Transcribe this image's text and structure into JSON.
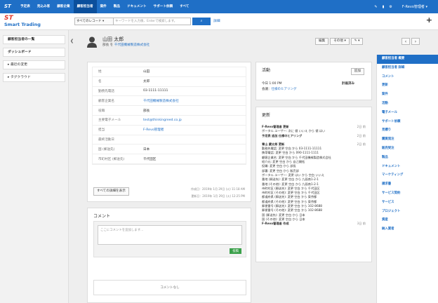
{
  "topnav": [
    "予定表",
    "見込み客",
    "顧客企業",
    "顧客担当者",
    "案件",
    "製品",
    "ドキュメント",
    "サポート依頼",
    "すべて"
  ],
  "topnav_active": 3,
  "user": "F-Revo管理者",
  "brand": {
    "st": "ST",
    "name": "Smart Trading"
  },
  "search": {
    "scope": "すべてのレコード",
    "placeholder": "キーワードを入力後、Enterで検索します。",
    "detail": "詳細"
  },
  "sidebar": {
    "items": [
      "顧客担当者の一覧",
      "ダッシュボード",
      "最近の変更",
      "タグクラウド"
    ]
  },
  "record": {
    "name": "山田 太郎",
    "role_prefix": "部長 を",
    "company": "千代田機械製造株式会社"
  },
  "actions": {
    "edit": "編集",
    "other": "その他",
    "tools": "🔧"
  },
  "fields": [
    {
      "label": "姓",
      "value": "山田",
      "link": false
    },
    {
      "label": "名",
      "value": "太郎",
      "link": false
    },
    {
      "label": "勤務先電話",
      "value": "03-1111-11111",
      "link": false
    },
    {
      "label": "顧客企業名",
      "value": "千代田機械製造株式会社",
      "link": true
    },
    {
      "label": "役職",
      "value": "部長",
      "link": false
    },
    {
      "label": "主要電子メール",
      "value": "test@thinkingreed.co.jp",
      "link": true
    },
    {
      "label": "担当",
      "value": "F-Revo管理者",
      "link": true
    },
    {
      "label": "最終活動日",
      "value": "",
      "link": false
    },
    {
      "label": "国 (郵送先)",
      "value": "日本",
      "link": false
    },
    {
      "label": "市町村区 (郵送先)",
      "value": "千代田区",
      "link": false
    }
  ],
  "show_all": "すべての詳細を表示",
  "created": "作成日：2019年 1月 29日 (火) 11:18 AM",
  "updated": "更新日：2019年 1月 29日 (火) 12:25 PM",
  "comment": {
    "title": "コメント",
    "placeholder": "ここにコメントを追加します...",
    "post": "投稿",
    "none": "コメントなし"
  },
  "activity": {
    "title": "活動",
    "add": "追加",
    "time": "今日 1:00 PM",
    "status": "計画済み",
    "label": "会議：",
    "item": "仕様のヒアリング"
  },
  "updates": {
    "title": "更新",
    "lines": [
      {
        "t": "F-Revo管理者 更新",
        "d": "2日 前"
      },
      {
        "t": "ポータル ユーザー: 次に 値 いいえ から 値 はい",
        "d": ""
      },
      {
        "t": "予定表 追加 仕様のヒアリング",
        "d": "2日 前"
      },
      {
        "t": "",
        "d": ""
      },
      {
        "t": "青山 慶太郎 更新",
        "d": "2日 前"
      },
      {
        "t": "勤務先電話: 変更 空白 から 03-1111-11111",
        "d": ""
      },
      {
        "t": "携帯電話: 変更 空白 から 090-1111-1111",
        "d": ""
      },
      {
        "t": "顧客企業名: 変更 空白 から 千代田機械製造株式会社",
        "d": ""
      },
      {
        "t": "紹介元: 変更 空白 から 自己開拓",
        "d": ""
      },
      {
        "t": "役職: 変更 空白 から 部長",
        "d": ""
      },
      {
        "t": "部署: 変更 空白 から 販売部",
        "d": ""
      },
      {
        "t": "ポータル ユーザー: 変更 はい から 空白 いいえ",
        "d": ""
      },
      {
        "t": "番地 (郵送先): 変更 空白 から 九段南1-2-1",
        "d": ""
      },
      {
        "t": "番地 (その他): 変更 空白 から 九段南1-2-1",
        "d": ""
      },
      {
        "t": "市町村区 (郵送先): 変更 空白 から 千代田区",
        "d": ""
      },
      {
        "t": "市町村区 (その他): 変更 空白 から 千代田区",
        "d": ""
      },
      {
        "t": "都道府県 (郵送先): 変更 空白 から 東京都",
        "d": ""
      },
      {
        "t": "都道府県 (その他): 変更 空白 から 東京都",
        "d": ""
      },
      {
        "t": "郵便番号 (郵送先): 変更 空白 から 102-8688",
        "d": ""
      },
      {
        "t": "郵便番号 (その他): 変更 空白 から 102-8688",
        "d": ""
      },
      {
        "t": "国 (郵送先): 変更 空白 から 日本",
        "d": ""
      },
      {
        "t": "国 (その他): 変更 空白 から 日本",
        "d": ""
      },
      {
        "t": "F-Revo管理者 作成",
        "d": "3日 前"
      }
    ]
  },
  "rightnav": [
    "顧客担当者 概要",
    "顧客担当者 詳細",
    "コメント",
    "更新",
    "案件",
    "活動",
    "電子メール",
    "サポート依頼",
    "見積り",
    "購買発注",
    "販売受注",
    "製品",
    "ドキュメント",
    "マーケティング",
    "請求書",
    "サービス契約",
    "サービス",
    "プロジェクト",
    "資産",
    "納入業者"
  ]
}
